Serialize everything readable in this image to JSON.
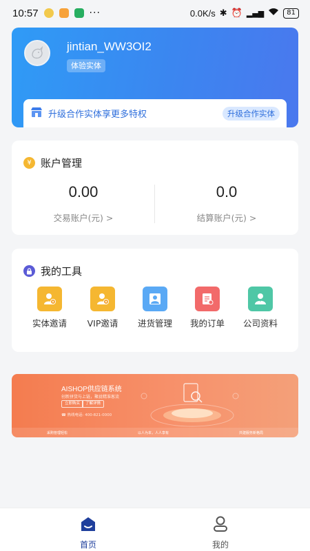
{
  "status_bar": {
    "time": "10:57",
    "net_speed": "0.0K/s",
    "battery": "81",
    "icons": [
      "bluetooth-icon",
      "alarm-icon",
      "hd-signal-icon",
      "wifi-icon",
      "battery-icon"
    ]
  },
  "user": {
    "name": "jintian_WW3OI2",
    "tag": "体验实体",
    "upgrade_text": "升级合作实体享更多特权",
    "upgrade_button": "升级合作实体"
  },
  "account": {
    "title": "账户管理",
    "icon_symbol": "¥",
    "items": [
      {
        "value": "0.00",
        "label": "交易账户(元) >"
      },
      {
        "value": "0.0",
        "label": "结算账户(元) >"
      }
    ]
  },
  "tools": {
    "title": "我的工具",
    "items": [
      {
        "label": "实体邀请",
        "icon": "user-invite-icon",
        "color": "#f5b731"
      },
      {
        "label": "VIP邀请",
        "icon": "vip-invite-icon",
        "color": "#f5b731"
      },
      {
        "label": "进货管理",
        "icon": "purchase-icon",
        "color": "#5aa9f5"
      },
      {
        "label": "我的订单",
        "icon": "order-icon",
        "color": "#f26a6a"
      },
      {
        "label": "公司资料",
        "icon": "company-icon",
        "color": "#4fc7a6"
      }
    ]
  },
  "banner": {
    "title": "AISHOP供应链系统",
    "subtitle": "创新拼货与上链，聚拢精准客流",
    "chip1": "立即购买",
    "chip2": "了解详情",
    "tel": "☎ 热线电话: 400-821-0000",
    "features": [
      "采购管理轻松",
      "以人为本，人人享有",
      "共建服务新格局"
    ]
  },
  "nav": {
    "home": "首页",
    "mine": "我的"
  },
  "colors": {
    "primary": "#2f6fdc",
    "nav_active": "#1f3f9c",
    "nav_inactive": "#555555"
  }
}
